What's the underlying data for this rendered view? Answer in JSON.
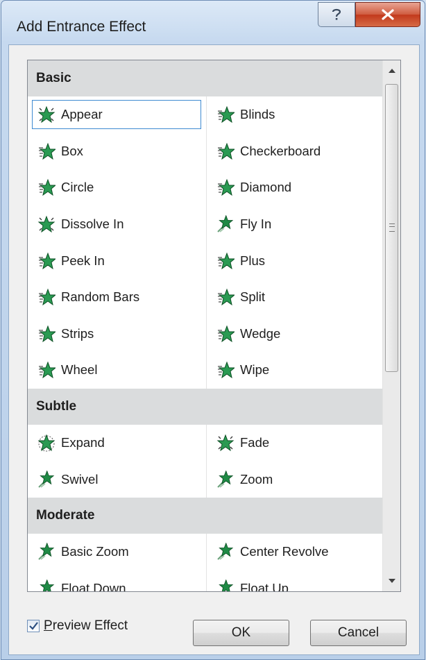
{
  "window": {
    "title": "Add Entrance Effect"
  },
  "sections": [
    {
      "name": "Basic",
      "items": [
        {
          "label": "Appear",
          "icon": "star-appear-icon"
        },
        {
          "label": "Blinds",
          "icon": "star-striped-icon"
        },
        {
          "label": "Box",
          "icon": "star-striped-icon"
        },
        {
          "label": "Checkerboard",
          "icon": "star-striped-icon"
        },
        {
          "label": "Circle",
          "icon": "star-striped-icon"
        },
        {
          "label": "Diamond",
          "icon": "star-striped-icon"
        },
        {
          "label": "Dissolve In",
          "icon": "star-appear-icon"
        },
        {
          "label": "Fly In",
          "icon": "star-motion-icon"
        },
        {
          "label": "Peek In",
          "icon": "star-striped-icon"
        },
        {
          "label": "Plus",
          "icon": "star-striped-icon"
        },
        {
          "label": "Random Bars",
          "icon": "star-striped-icon"
        },
        {
          "label": "Split",
          "icon": "star-striped-icon"
        },
        {
          "label": "Strips",
          "icon": "star-striped-icon"
        },
        {
          "label": "Wedge",
          "icon": "star-striped-icon"
        },
        {
          "label": "Wheel",
          "icon": "star-striped-icon"
        },
        {
          "label": "Wipe",
          "icon": "star-striped-icon"
        }
      ]
    },
    {
      "name": "Subtle",
      "items": [
        {
          "label": "Expand",
          "icon": "star-expand-icon"
        },
        {
          "label": "Fade",
          "icon": "star-appear-icon"
        },
        {
          "label": "Swivel",
          "icon": "star-motion-icon"
        },
        {
          "label": "Zoom",
          "icon": "star-motion-icon"
        }
      ]
    },
    {
      "name": "Moderate",
      "items": [
        {
          "label": "Basic Zoom",
          "icon": "star-motion-icon"
        },
        {
          "label": "Center Revolve",
          "icon": "star-motion-icon"
        },
        {
          "label": "Float Down",
          "icon": "star-motion-icon"
        },
        {
          "label": "Float Up",
          "icon": "star-motion-icon"
        }
      ]
    }
  ],
  "selected_effect": "Appear",
  "preview": {
    "label": "Preview Effect",
    "checked": true
  },
  "buttons": {
    "ok": "OK",
    "cancel": "Cancel"
  },
  "colors": {
    "accent": "#3d8ad1",
    "star": "#1a7a3a",
    "close": "#c2391c"
  }
}
